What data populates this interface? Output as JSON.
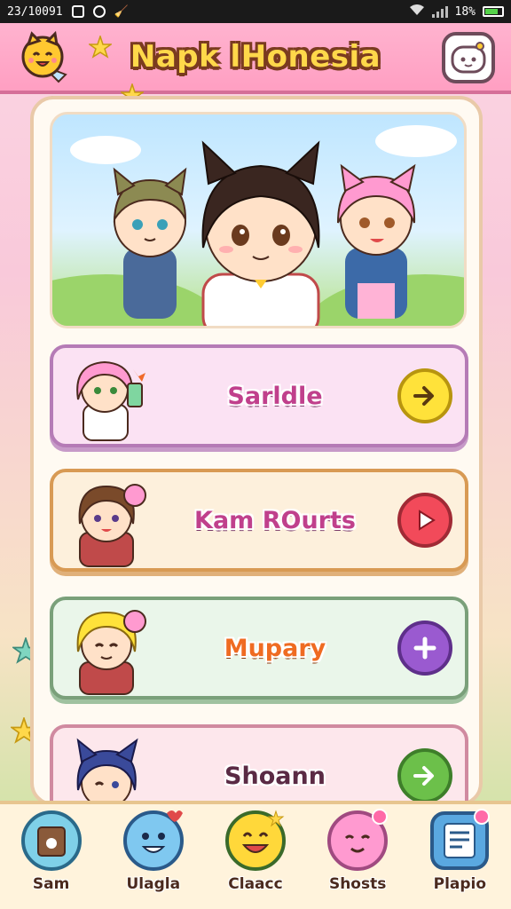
{
  "status_bar": {
    "time": "23/10091",
    "battery_text": "18%"
  },
  "header": {
    "title": "Napk lHonesia"
  },
  "menu": [
    {
      "label": "Sarldle",
      "action_icon": "arrow-right-icon",
      "accent": "#ffe23a"
    },
    {
      "label": "Kam ROurts",
      "action_icon": "play-icon",
      "accent": "#f24a5a"
    },
    {
      "label": "Mupary",
      "action_icon": "plus-icon",
      "accent": "#9a5ad0"
    },
    {
      "label": "Shoann",
      "action_icon": "arrow-right-icon",
      "accent": "#6cc04a"
    }
  ],
  "bottom_nav": [
    {
      "label": "Sam",
      "icon": "ticket-icon"
    },
    {
      "label": "Ulagla",
      "icon": "blue-creature-icon"
    },
    {
      "label": "Claacc",
      "icon": "smiley-icon"
    },
    {
      "label": "Shosts",
      "icon": "pink-blob-icon"
    },
    {
      "label": "Plapio",
      "icon": "document-icon"
    }
  ],
  "colors": {
    "header_bg": "#ff9fc2",
    "title_fill": "#ffd84a",
    "panel_bg": "#fffaf2"
  }
}
